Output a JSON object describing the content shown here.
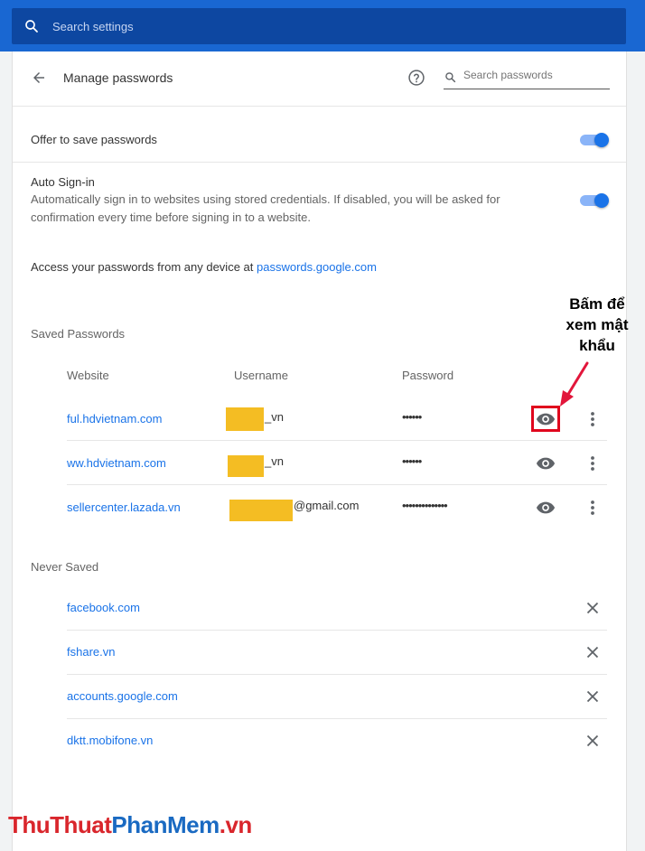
{
  "app": {
    "search_placeholder": "Search settings"
  },
  "header": {
    "title": "Manage passwords",
    "search_placeholder": "Search passwords",
    "back_icon": "arrow-back-icon",
    "help_icon": "help-circle-icon"
  },
  "offer_save": {
    "label": "Offer to save passwords",
    "enabled": true
  },
  "auto_signin": {
    "label": "Auto Sign-in",
    "description_line1": "Automatically sign in to websites using stored credentials. If disabled, you will be asked for",
    "description_line2": "confirmation every time before signing in to a website.",
    "enabled": true
  },
  "access": {
    "text": "Access your passwords from any device at ",
    "link": "passwords.google.com"
  },
  "saved_passwords": {
    "title": "Saved Passwords",
    "columns": [
      "Website",
      "Username",
      "Password"
    ],
    "rows": [
      {
        "website": "ful.hdvietnam.com",
        "username": "_vn",
        "password": "••••••"
      },
      {
        "website": "ww.hdvietnam.com",
        "username": "_vn",
        "password": "••••••"
      },
      {
        "website": "sellercenter.lazada.vn",
        "username": "@gmail.com",
        "password": "••••••••••••••"
      }
    ]
  },
  "never_saved": {
    "title": "Never Saved",
    "rows": [
      "facebook.com",
      "fshare.vn",
      "accounts.google.com",
      "dktt.mobifone.vn"
    ]
  },
  "annotation": {
    "line1": "Bấm để",
    "line2": "xem mật",
    "line3": "khẩu"
  },
  "watermark": {
    "part1": "ThuThuat",
    "part2": "PhanMem",
    "part3": ".vn"
  },
  "colors": {
    "topbar": "#1967d2",
    "accent": "#1a73e8",
    "highlight": "#e0061d",
    "mask": "#f4bd23"
  }
}
